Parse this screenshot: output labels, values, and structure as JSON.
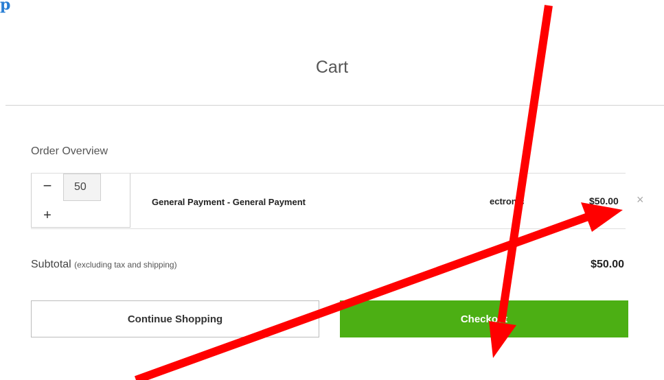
{
  "corner": {
    "glyph": "p"
  },
  "cart": {
    "title": "Cart"
  },
  "order": {
    "heading": "Order Overview"
  },
  "item": {
    "quantity": "50",
    "minus_symbol": "−",
    "plus_symbol": "+",
    "name": "General Payment - General Payment",
    "type": "ectronic",
    "price": "$50.00",
    "remove_icon": "close-icon",
    "remove_symbol": "×"
  },
  "summary": {
    "subtotal_label": "Subtotal",
    "subtotal_note": "(excluding tax and shipping)",
    "subtotal_value": "$50.00"
  },
  "actions": {
    "continue_label": "Continue Shopping",
    "checkout_label": "Checkout"
  },
  "colors": {
    "checkout_green": "#4caf14",
    "annotation_red": "#ff0000",
    "corner_blue": "#2a7fd4"
  }
}
